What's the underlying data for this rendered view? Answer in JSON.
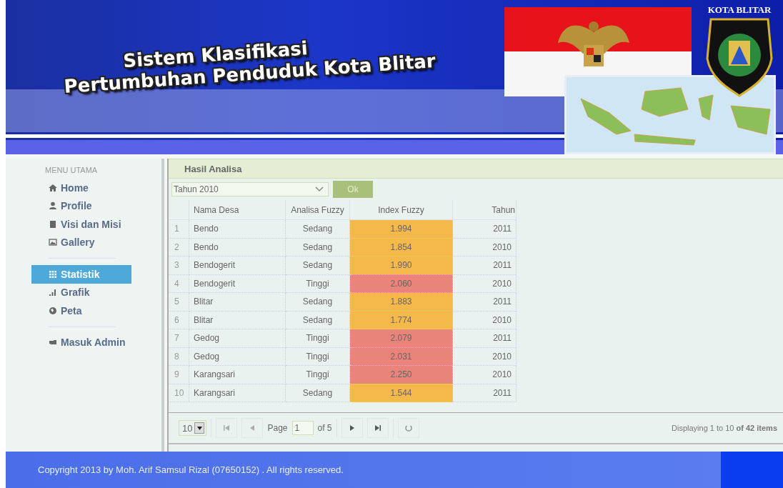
{
  "header": {
    "title_line_1": "Sistem Klasifikasi",
    "title_line_2": "Pertumbuhan Penduduk Kota Blitar",
    "emblem_label": "KOTA BLITAR"
  },
  "sidebar": {
    "heading": "MENU UTAMA",
    "groups": [
      {
        "items": [
          {
            "label": "Home",
            "selected": false
          },
          {
            "label": "Profile",
            "selected": false
          },
          {
            "label": "Visi dan Misi",
            "selected": false
          },
          {
            "label": "Gallery",
            "selected": false
          }
        ]
      },
      {
        "items": [
          {
            "label": "Statistik",
            "selected": true
          },
          {
            "label": "Grafik",
            "selected": false
          },
          {
            "label": "Peta",
            "selected": false
          }
        ]
      },
      {
        "items": [
          {
            "label": "Masuk Admin",
            "selected": false
          }
        ]
      }
    ]
  },
  "panel": {
    "title": "Hasil Analisa",
    "year_select": {
      "value": "Tahun 2010"
    },
    "ok_button": "Ok",
    "table": {
      "columns": [
        "Nama Desa",
        "Analisa Fuzzy",
        "Index Fuzzy",
        "Tahun"
      ],
      "rows": [
        {
          "no": "1",
          "nama": "Bendo",
          "analisa": "Sedang",
          "index": "1.994",
          "tahun": "2011",
          "color": "#f5b84a"
        },
        {
          "no": "2",
          "nama": "Bendo",
          "analisa": "Sedang",
          "index": "1.854",
          "tahun": "2010",
          "color": "#f5b84a"
        },
        {
          "no": "3",
          "nama": "Bendogerit",
          "analisa": "Sedang",
          "index": "1.990",
          "tahun": "2011",
          "color": "#f5b84a"
        },
        {
          "no": "4",
          "nama": "Bendogerit",
          "analisa": "Tinggi",
          "index": "2.060",
          "tahun": "2010",
          "color": "#e8847a"
        },
        {
          "no": "5",
          "nama": "Blitar",
          "analisa": "Sedang",
          "index": "1.883",
          "tahun": "2011",
          "color": "#f5b84a"
        },
        {
          "no": "6",
          "nama": "Blitar",
          "analisa": "Sedang",
          "index": "1.774",
          "tahun": "2010",
          "color": "#f5b84a"
        },
        {
          "no": "7",
          "nama": "Gedog",
          "analisa": "Tinggi",
          "index": "2.079",
          "tahun": "2011",
          "color": "#e8847a"
        },
        {
          "no": "8",
          "nama": "Gedog",
          "analisa": "Tinggi",
          "index": "2.031",
          "tahun": "2010",
          "color": "#e8847a"
        },
        {
          "no": "9",
          "nama": "Karangsari",
          "analisa": "Tinggi",
          "index": "2.250",
          "tahun": "2010",
          "color": "#e8847a"
        },
        {
          "no": "10",
          "nama": "Karangsari",
          "analisa": "Sedang",
          "index": "1.544",
          "tahun": "2011",
          "color": "#f5b84a"
        }
      ]
    },
    "pager": {
      "page_size": "10",
      "page_label": "Page",
      "page": "1",
      "of_label": "of 5",
      "summary": "Displaying 1 to 10 **of 42 items**"
    }
  },
  "footer": {
    "copyright": "Copyright 2013 by Moh. Arif Samsul Rizal (07650152) . All rights reserved."
  }
}
